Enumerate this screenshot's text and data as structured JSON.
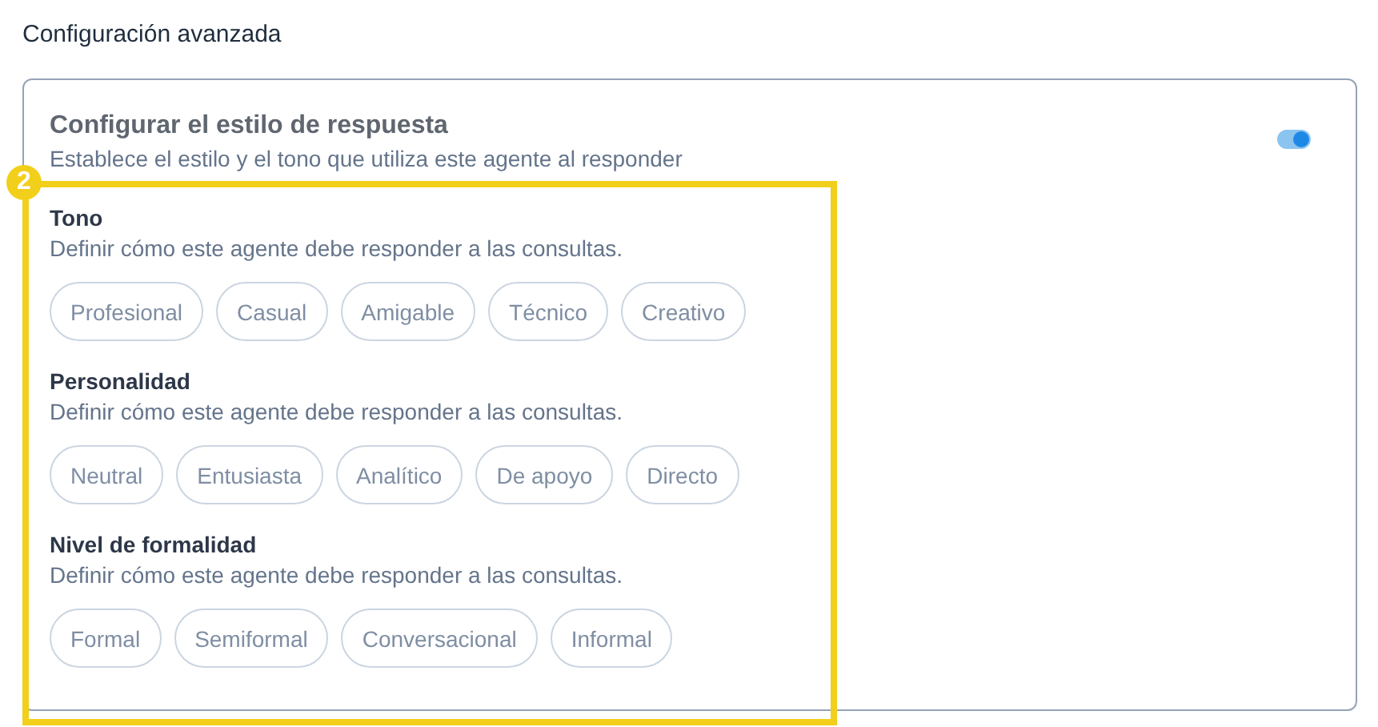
{
  "page_title": "Configuración avanzada",
  "card": {
    "title": "Configurar el estilo de respuesta",
    "subtitle": "Establece el estilo y el tono que utiliza este agente al responder",
    "toggle": {
      "on": true
    },
    "groups": [
      {
        "label": "Tono",
        "description": "Definir cómo este agente debe responder a las consultas.",
        "options": [
          "Profesional",
          "Casual",
          "Amigable",
          "Técnico",
          "Creativo"
        ]
      },
      {
        "label": "Personalidad",
        "description": "Definir cómo este agente debe responder a las consultas.",
        "options": [
          "Neutral",
          "Entusiasta",
          "Analítico",
          "De apoyo",
          "Directo"
        ]
      },
      {
        "label": "Nivel de formalidad",
        "description": "Definir cómo este agente debe responder a las consultas.",
        "options": [
          "Formal",
          "Semiformal",
          "Conversacional",
          "Informal"
        ]
      }
    ]
  },
  "annotation": {
    "number": "2"
  }
}
